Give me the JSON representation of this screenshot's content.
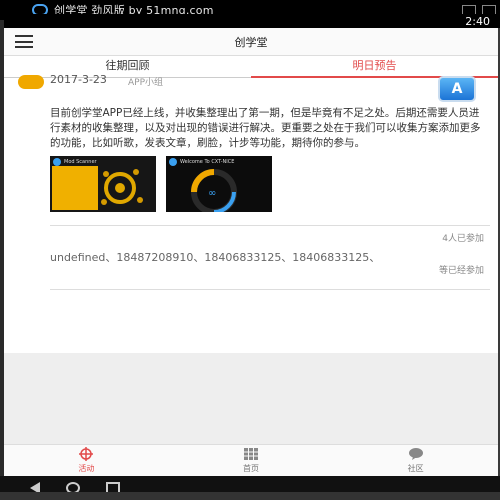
{
  "emulator": {
    "title": "创学堂 劲风版 by 51mnq.com",
    "clock": "2:40"
  },
  "app": {
    "title": "创学堂"
  },
  "tabs": [
    {
      "label": "往期回顾",
      "active": false
    },
    {
      "label": "明日预告",
      "active": true
    }
  ],
  "post": {
    "date": "2017-3-23",
    "group": "APP小组",
    "body": "目前创学堂APP已经上线，并收集整理出了第一期，但是毕竟有不足之处。后期还需要人员进行素材的收集整理，以及对出现的错误进行解决。更重要之处在于我们可以收集方案添加更多的功能，比如听歌，发表文章，刷脸，计步等功能，期待你的参与。",
    "thumb_1_caption": "Mod Scanner",
    "thumb_2_caption": "Welcome To CXT-NICE",
    "joined_count": "4人已参加",
    "participants": "undefined、18487208910、18406833125、18406833125、",
    "waiting": "等已经参加"
  },
  "bottom_nav": [
    {
      "label": "活动",
      "icon": "crosshair-icon",
      "active": true
    },
    {
      "label": "首页",
      "icon": "grid-icon",
      "active": false
    },
    {
      "label": "社区",
      "icon": "chat-icon",
      "active": false
    }
  ],
  "colors": {
    "accent": "#e24a4a",
    "avatar": "#f0a800",
    "appstore": "#1c74d6"
  }
}
